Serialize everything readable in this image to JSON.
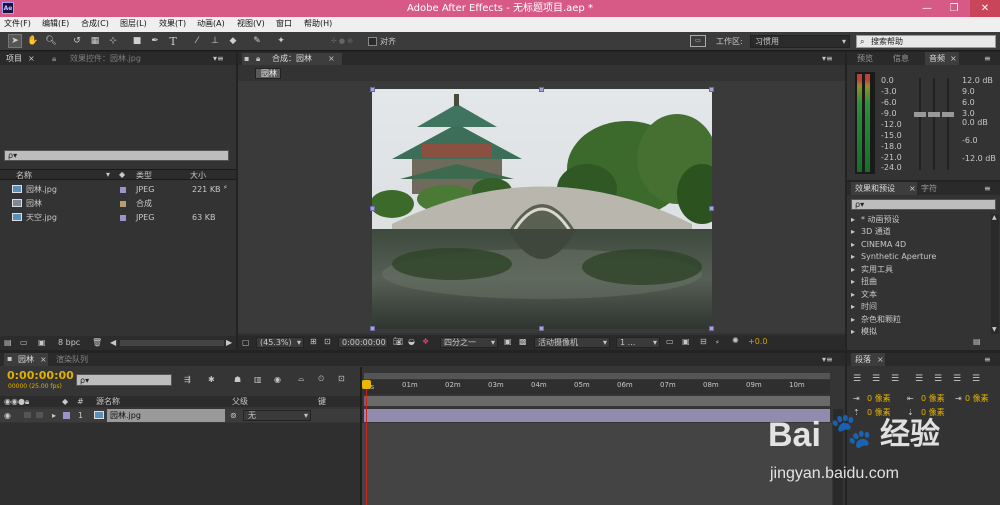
{
  "window": {
    "app_icon": "Ae",
    "title": "Adobe After Effects - 无标题项目.aep *",
    "minimize": "—",
    "restore": "❐",
    "close": "✕"
  },
  "menu": [
    "文件(F)",
    "编辑(E)",
    "合成(C)",
    "图层(L)",
    "效果(T)",
    "动画(A)",
    "视图(V)",
    "窗口",
    "帮助(H)"
  ],
  "toolbar": {
    "snap_label": "对齐",
    "workspace_label": "工作区:",
    "workspace_value": "习惯用",
    "search_placeholder": "搜索帮助"
  },
  "project_panel": {
    "tab_project": "项目",
    "tab_effect_controls": "效果控件：园林.jpg",
    "search_icon_label": "ρ▾",
    "columns": {
      "name": "名称",
      "type": "类型",
      "size": "大小"
    },
    "items": [
      {
        "name": "园林.jpg",
        "type": "JPEG",
        "size": "221 KB",
        "label_color": "#9b93cc"
      },
      {
        "name": "园林",
        "type": "合成",
        "size": "",
        "label_color": "#b5a06b"
      },
      {
        "name": "天空.jpg",
        "type": "JPEG",
        "size": "63 KB",
        "label_color": "#9b93cc"
      }
    ],
    "bpc": "8 bpc"
  },
  "comp_panel": {
    "tab_label": "合成：园林",
    "breadcrumb": "园林",
    "zoom": "(45.3%)",
    "timecode": "0:00:00:00",
    "resolution": "四分之一",
    "camera": "活动摄像机",
    "views": "1 ...",
    "exposure": "+0.0"
  },
  "info_panel": {
    "tabs": [
      "预览",
      "信息",
      "音频"
    ],
    "levels_left": [
      "0.0",
      "-3.0",
      "-6.0",
      "-9.0",
      "-12.0",
      "-15.0",
      "-18.0",
      "-21.0",
      "-24.0"
    ],
    "levels_right": [
      "12.0 dB",
      "9.0",
      "6.0",
      "3.0",
      "0.0 dB",
      "-6.0",
      "-12.0 dB"
    ]
  },
  "effects_panel": {
    "tabs": [
      "效果和预设",
      "字符"
    ],
    "search_icon_label": "ρ▾",
    "items": [
      "* 动画预设",
      "3D 通道",
      "CINEMA 4D",
      "Synthetic Aperture",
      "实用工具",
      "扭曲",
      "文本",
      "时间",
      "杂色和颗粒",
      "模拟"
    ]
  },
  "timeline": {
    "tab_comp": "园林",
    "tab_render": "渲染队列",
    "timecode": "0:00:00:00",
    "frames": "00000 (25.00 fps)",
    "search_icon_label": "ρ▾",
    "columns": {
      "num": "#",
      "source": "源名称",
      "parent": "父级",
      "key": "键"
    },
    "ruler": [
      "0s",
      "01m",
      "02m",
      "03m",
      "04m",
      "05m",
      "06m",
      "07m",
      "08m",
      "09m",
      "10m"
    ],
    "layers": [
      {
        "num": "1",
        "name": "园林.jpg",
        "parent": "无"
      }
    ]
  },
  "paragraph_panel": {
    "tab": "段落",
    "units": [
      "0 像素",
      "0 像素",
      "0 像素",
      "0 像素",
      "0 像素"
    ]
  },
  "watermark": {
    "brand": "Bai",
    "paw": "🐾",
    "du": "经验",
    "url": "jingyan.baidu.com"
  }
}
